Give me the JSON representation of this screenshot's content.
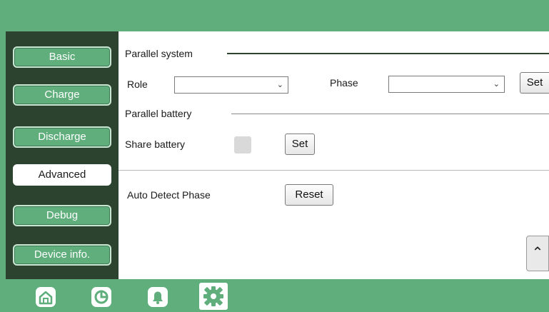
{
  "sidebar": {
    "items": [
      {
        "label": "Basic"
      },
      {
        "label": "Charge"
      },
      {
        "label": "Discharge"
      },
      {
        "label": "Advanced"
      },
      {
        "label": "Debug"
      },
      {
        "label": "Device info."
      }
    ],
    "active": "Advanced"
  },
  "parallel_system": {
    "title": "Parallel system",
    "role_label": "Role",
    "role_value": "",
    "phase_label": "Phase",
    "phase_value": "",
    "set_label": "Set"
  },
  "parallel_battery": {
    "title": "Parallel battery",
    "share_label": "Share battery",
    "share_checked": false,
    "set_label": "Set"
  },
  "auto_detect": {
    "label": "Auto Detect Phase",
    "reset_label": "Reset"
  },
  "bottom_nav": {
    "items": [
      "home-icon",
      "pie-chart-icon",
      "bell-icon",
      "gear-icon"
    ],
    "active": "gear-icon"
  },
  "colors": {
    "accent_green": "#5fae7c",
    "sidebar_dark": "#2c4330"
  }
}
